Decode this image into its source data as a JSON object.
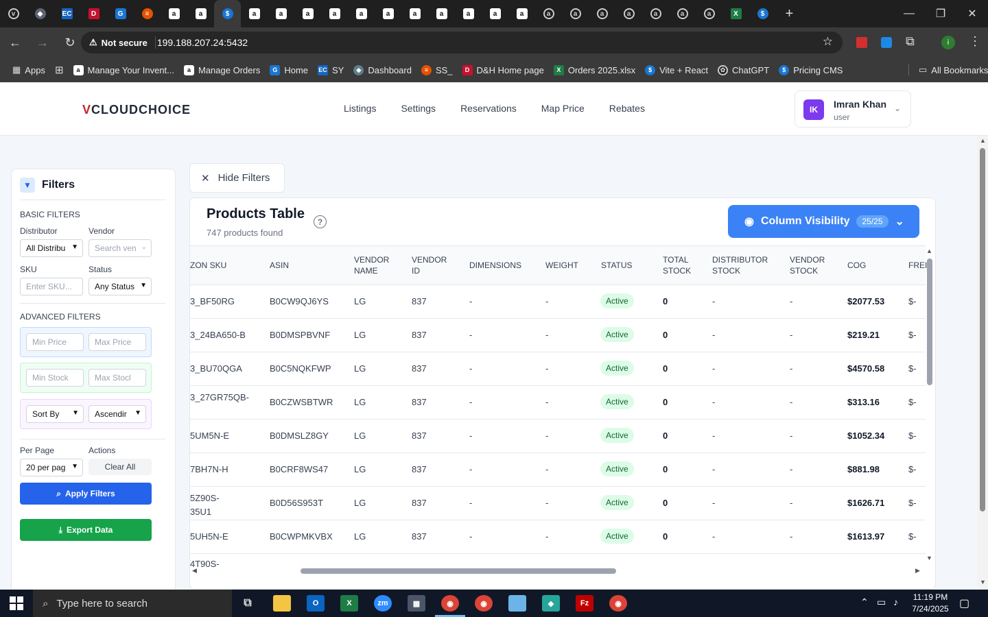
{
  "browser": {
    "url": "199.188.207.24:5432",
    "security_label": "Not secure",
    "bookmarks": [
      {
        "label": "Apps",
        "icon": "apps-grid"
      },
      {
        "label": "Manage Your Invent...",
        "icon": "amazon"
      },
      {
        "label": "Manage Orders",
        "icon": "amazon"
      },
      {
        "label": "Home",
        "icon": "blue-square"
      },
      {
        "label": "SY",
        "icon": "ec"
      },
      {
        "label": "Dashboard",
        "icon": "teal"
      },
      {
        "label": "SS_",
        "icon": "stack"
      },
      {
        "label": "D&H Home page",
        "icon": "red-square"
      },
      {
        "label": "Orders 2025.xlsx",
        "icon": "excel"
      },
      {
        "label": "Vite + React",
        "icon": "dollar"
      },
      {
        "label": "ChatGPT",
        "icon": "chatgpt"
      },
      {
        "label": "Pricing CMS",
        "icon": "dollar"
      }
    ],
    "all_bookmarks": "All Bookmarks"
  },
  "header": {
    "logo_mark": "V",
    "logo_text": "CLOUDCHOICE",
    "nav": [
      "Listings",
      "Settings",
      "Reservations",
      "Map Price",
      "Rebates"
    ],
    "user": {
      "initials": "IK",
      "name": "Imran Khan",
      "role": "user"
    }
  },
  "filters": {
    "title": "Filters",
    "basic_title": "BASIC FILTERS",
    "distributor_label": "Distributor",
    "distributor_value": "All Distribu",
    "vendor_label": "Vendor",
    "vendor_placeholder": "Search ven",
    "sku_label": "SKU",
    "sku_placeholder": "Enter SKU...",
    "status_label": "Status",
    "status_value": "Any Status",
    "advanced_title": "ADVANCED FILTERS",
    "min_price": "Min Price",
    "max_price": "Max Price",
    "min_stock": "Min Stock",
    "max_stock": "Max Stocl",
    "sort_by": "Sort By",
    "order": "Ascendir",
    "per_page_label": "Per Page",
    "per_page_value": "20 per pag",
    "actions_label": "Actions",
    "clear_all": "Clear All",
    "apply": "Apply Filters",
    "export": "Export Data",
    "colors": {
      "apply": "#2563eb",
      "export": "#16a34a"
    }
  },
  "hide_filters": "Hide Filters",
  "table": {
    "title": "Products Table",
    "count_text": "747 products found",
    "column_visibility": "Column Visibility",
    "visibility_count": "25/25",
    "headers": [
      "ZON SKU",
      "ASIN",
      "VENDOR NAME",
      "VENDOR ID",
      "DIMENSIONS",
      "WEIGHT",
      "STATUS",
      "TOTAL STOCK",
      "DISTRIBUTOR STOCK",
      "VENDOR STOCK",
      "COG",
      "FREI"
    ],
    "rows": [
      {
        "sku": "3_BF50RG",
        "asin": "B0CW9QJ6YS",
        "vendor": "LG",
        "vid": "837",
        "dim": "-",
        "wt": "-",
        "status": "Active",
        "total": "0",
        "dist": "-",
        "vstock": "-",
        "cog": "$2077.53",
        "fre": "$-"
      },
      {
        "sku": "3_24BA650-B",
        "asin": "B0DMSPBVNF",
        "vendor": "LG",
        "vid": "837",
        "dim": "-",
        "wt": "-",
        "status": "Active",
        "total": "0",
        "dist": "-",
        "vstock": "-",
        "cog": "$219.21",
        "fre": "$-"
      },
      {
        "sku": "3_BU70QGA",
        "asin": "B0C5NQKFWP",
        "vendor": "LG",
        "vid": "837",
        "dim": "-",
        "wt": "-",
        "status": "Active",
        "total": "0",
        "dist": "-",
        "vstock": "-",
        "cog": "$4570.58",
        "fre": "$-"
      },
      {
        "sku": "3_27GR75QB-",
        "asin": "B0CZWSBTWR",
        "vendor": "LG",
        "vid": "837",
        "dim": "-",
        "wt": "-",
        "status": "Active",
        "total": "0",
        "dist": "-",
        "vstock": "-",
        "cog": "$313.16",
        "fre": "$-"
      },
      {
        "sku": "5UM5N-E",
        "asin": "B0DMSLZ8GY",
        "vendor": "LG",
        "vid": "837",
        "dim": "-",
        "wt": "-",
        "status": "Active",
        "total": "0",
        "dist": "-",
        "vstock": "-",
        "cog": "$1052.34",
        "fre": "$-"
      },
      {
        "sku": "7BH7N-H",
        "asin": "B0CRF8WS47",
        "vendor": "LG",
        "vid": "837",
        "dim": "-",
        "wt": "-",
        "status": "Active",
        "total": "0",
        "dist": "-",
        "vstock": "-",
        "cog": "$881.98",
        "fre": "$-"
      },
      {
        "sku": "5Z90S-35U1",
        "asin": "B0D56S953T",
        "vendor": "LG",
        "vid": "837",
        "dim": "-",
        "wt": "-",
        "status": "Active",
        "total": "0",
        "dist": "-",
        "vstock": "-",
        "cog": "$1626.71",
        "fre": "$-"
      },
      {
        "sku": "5UH5N-E",
        "asin": "B0CWPMKVBX",
        "vendor": "LG",
        "vid": "837",
        "dim": "-",
        "wt": "-",
        "status": "Active",
        "total": "0",
        "dist": "-",
        "vstock": "-",
        "cog": "$1613.97",
        "fre": "$-"
      },
      {
        "sku": "4T90S-",
        "asin": "",
        "vendor": "",
        "vid": "",
        "dim": "",
        "wt": "",
        "status": "",
        "total": "",
        "dist": "",
        "vstock": "",
        "cog": "",
        "fre": ""
      }
    ]
  },
  "taskbar": {
    "search_placeholder": "Type here to search",
    "time": "11:19 PM",
    "date": "7/24/2025"
  }
}
